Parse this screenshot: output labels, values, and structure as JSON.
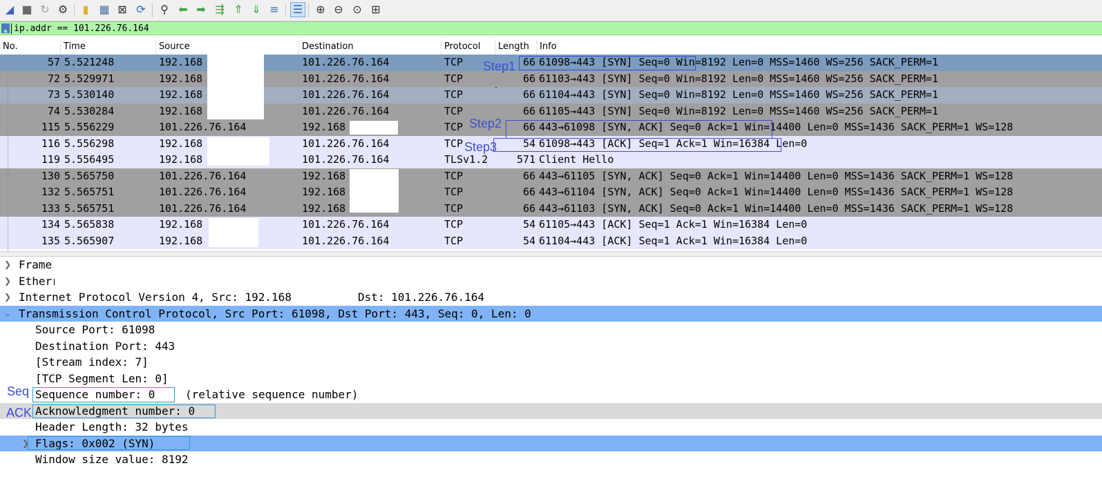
{
  "toolbar": {
    "buttons": [
      {
        "name": "shark-fin-start-icon",
        "glyph": "◢",
        "color": "#3b63c4"
      },
      {
        "name": "stop-square-icon",
        "glyph": "■",
        "color": "#6a6a6a"
      },
      {
        "name": "restart-fin-icon",
        "glyph": "↻",
        "color": "#9a9a9a"
      },
      {
        "name": "capture-options-gear-icon",
        "glyph": "⚙",
        "color": "#333333"
      },
      {
        "name": "open-file-icon",
        "glyph": "▮",
        "color": "#e2b12f"
      },
      {
        "name": "save-file-icon",
        "glyph": "▦",
        "color": "#4a6fa5"
      },
      {
        "name": "close-file-icon",
        "glyph": "⊠",
        "color": "#333333"
      },
      {
        "name": "reload-file-icon",
        "glyph": "⟳",
        "color": "#2f6fb5"
      },
      {
        "name": "find-packet-icon",
        "glyph": "⚲",
        "color": "#333333"
      },
      {
        "name": "go-back-icon",
        "glyph": "⬅",
        "color": "#3fa33f"
      },
      {
        "name": "go-forward-icon",
        "glyph": "➡",
        "color": "#3fa33f"
      },
      {
        "name": "go-to-packet-icon",
        "glyph": "⇶",
        "color": "#3fa33f"
      },
      {
        "name": "first-packet-icon",
        "glyph": "⇑",
        "color": "#3fa33f"
      },
      {
        "name": "last-packet-icon",
        "glyph": "⇓",
        "color": "#3fa33f"
      },
      {
        "name": "autoscroll-icon",
        "glyph": "≡",
        "color": "#2f6fb5"
      },
      {
        "name": "colorize-icon",
        "glyph": "☰",
        "color": "#2f6fb5"
      },
      {
        "name": "zoom-in-icon",
        "glyph": "⊕",
        "color": "#333333"
      },
      {
        "name": "zoom-out-icon",
        "glyph": "⊖",
        "color": "#333333"
      },
      {
        "name": "normal-size-icon",
        "glyph": "⊙",
        "color": "#333333"
      },
      {
        "name": "resize-columns-icon",
        "glyph": "⊞",
        "color": "#333333"
      }
    ]
  },
  "filter": {
    "value": "ip.addr == 101.226.76.164"
  },
  "columns": [
    "No.",
    "Time",
    "Source",
    "Destination",
    "Protocol",
    "Length",
    "Info"
  ],
  "packets": [
    {
      "no": "57",
      "time": "5.521248",
      "src": "192.168",
      "dst": "101.226.76.164",
      "proto": "TCP",
      "len": "66",
      "info": "61098→443 [SYN] Seq=0 Win=8192 Len=0 MSS=1460 WS=256 SACK_PERM=1",
      "tone": "sel"
    },
    {
      "no": "72",
      "time": "5.529971",
      "src": "192.168",
      "dst": "101.226.76.164",
      "proto": "TCP",
      "len": "66",
      "info": "61103→443 [SYN] Seq=0 Win=8192 Len=0 MSS=1460 WS=256 SACK_PERM=1",
      "tone": "syn"
    },
    {
      "no": "73",
      "time": "5.530140",
      "src": "192.168",
      "dst": "101.226.76.164",
      "proto": "TCP",
      "len": "66",
      "info": "61104→443 [SYN] Seq=0 Win=8192 Len=0 MSS=1460 WS=256 SACK_PERM=1",
      "tone": "synblue"
    },
    {
      "no": "74",
      "time": "5.530284",
      "src": "192.168",
      "dst": "101.226.76.164",
      "proto": "TCP",
      "len": "66",
      "info": "61105→443 [SYN] Seq=0 Win=8192 Len=0 MSS=1460 WS=256 SACK_PERM=1",
      "tone": "syn"
    },
    {
      "no": "115",
      "time": "5.556229",
      "src": "101.226.76.164",
      "dst": "192.168",
      "proto": "TCP",
      "len": "66",
      "info": "443→61098 [SYN, ACK] Seq=0 Ack=1 Win=14400 Len=0 MSS=1436 SACK_PERM=1 WS=128",
      "tone": "syn"
    },
    {
      "no": "116",
      "time": "5.556298",
      "src": "192.168",
      "dst": "101.226.76.164",
      "proto": "TCP",
      "len": "54",
      "info": "61098→443 [ACK] Seq=1 Ack=1 Win=16384 Len=0",
      "tone": "ack"
    },
    {
      "no": "119",
      "time": "5.556495",
      "src": "192.168",
      "dst": "101.226.76.164",
      "proto": "TLSv1.2",
      "len": "571",
      "info": "Client Hello",
      "tone": "ack"
    },
    {
      "no": "130",
      "time": "5.565750",
      "src": "101.226.76.164",
      "dst": "192.168",
      "proto": "TCP",
      "len": "66",
      "info": "443→61105 [SYN, ACK] Seq=0 Ack=1 Win=14400 Len=0 MSS=1436 SACK_PERM=1 WS=128",
      "tone": "syn"
    },
    {
      "no": "132",
      "time": "5.565751",
      "src": "101.226.76.164",
      "dst": "192.168",
      "proto": "TCP",
      "len": "66",
      "info": "443→61104 [SYN, ACK] Seq=0 Ack=1 Win=14400 Len=0 MSS=1436 SACK_PERM=1 WS=128",
      "tone": "syn"
    },
    {
      "no": "133",
      "time": "5.565751",
      "src": "101.226.76.164",
      "dst": "192.168",
      "proto": "TCP",
      "len": "66",
      "info": "443→61103 [SYN, ACK] Seq=0 Ack=1 Win=14400 Len=0 MSS=1436 SACK_PERM=1 WS=128",
      "tone": "syn"
    },
    {
      "no": "134",
      "time": "5.565838",
      "src": "192.168",
      "dst": "101.226.76.164",
      "proto": "TCP",
      "len": "54",
      "info": "61105→443 [ACK] Seq=1 Ack=1 Win=16384 Len=0",
      "tone": "ack"
    },
    {
      "no": "135",
      "time": "5.565907",
      "src": "192.168",
      "dst": "101.226.76.164",
      "proto": "TCP",
      "len": "54",
      "info": "61104→443 [ACK] Seq=1 Ack=1 Win=16384 Len=0",
      "tone": "ack"
    }
  ],
  "annotations": {
    "step1": "Step1",
    "step2": "Step2",
    "step3": "Step3",
    "seq": "Seq",
    "ack": "ACK"
  },
  "details": {
    "frame": "Frame",
    "ethernet": "Etherr",
    "ip": "Internet Protocol Version 4, Src: 192.168",
    "ip_dst": "Dst: 101.226.76.164",
    "tcp": "Transmission Control Protocol, Src Port: 61098, Dst Port: 443, Seq: 0, Len: 0",
    "fields": {
      "src_port": "Source Port: 61098",
      "dst_port": "Destination Port: 443",
      "stream": "[Stream index: 7]",
      "seglen": "[TCP Segment Len: 0]",
      "seq": "Sequence number: 0",
      "seq_rel": "(relative sequence number)",
      "ack": "Acknowledgment number: 0",
      "hdrlen": "Header Length: 32 bytes",
      "flags": "Flags: 0x002 (SYN)",
      "window": "Window size value: 8192"
    }
  },
  "colors": {
    "syn": "#a0a0a0",
    "sel": "#7b9cbf",
    "synblue": "#a3aec0",
    "ack": "#e7e6ff",
    "annotation": "#3d4ed4",
    "filter": "#aef5a9"
  }
}
